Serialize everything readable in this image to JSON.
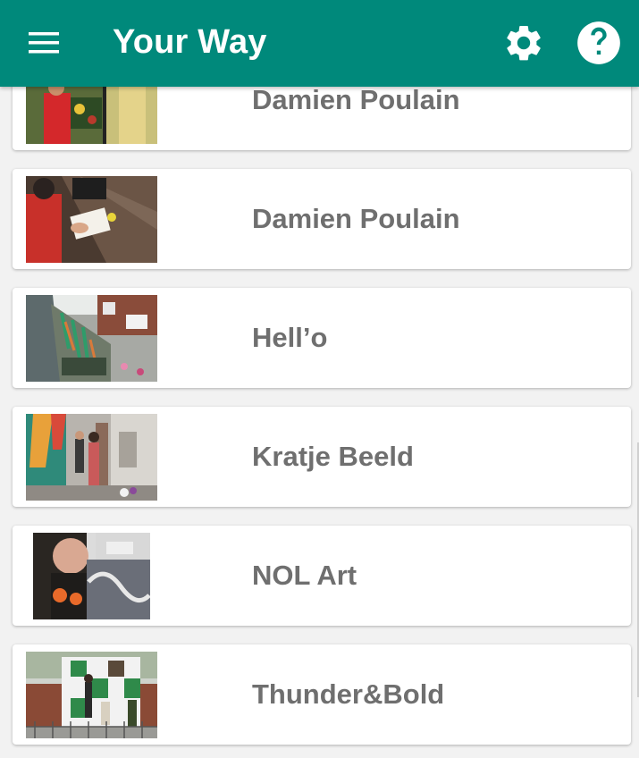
{
  "appbar": {
    "title": "Your Way",
    "color": "#00897b",
    "menu_icon": "hamburger-menu-icon",
    "settings_icon": "gear-icon",
    "help_icon": "help-circle-icon"
  },
  "artists": [
    {
      "name": "Damien Poulain",
      "image": "street art work photo"
    },
    {
      "name": "Damien Poulain",
      "image": "artist drawing on paper"
    },
    {
      "name": "Hell’o",
      "image": "mural on building wall"
    },
    {
      "name": "Kratje Beeld",
      "image": "people at painted alley"
    },
    {
      "name": "NOL Art",
      "image": "artist painting mural"
    },
    {
      "name": "Thunder&Bold",
      "image": "painted house facade"
    }
  ]
}
